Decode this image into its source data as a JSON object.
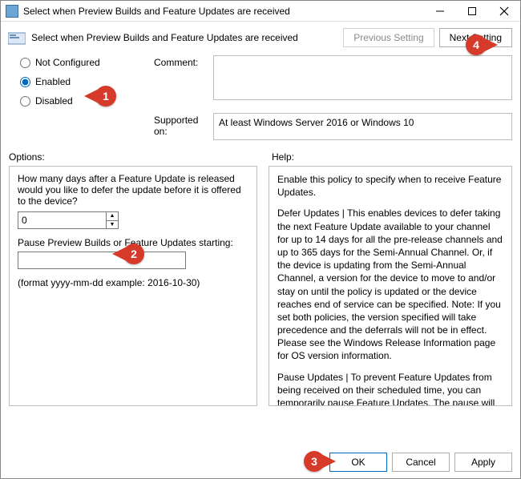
{
  "window": {
    "title": "Select when Preview Builds and Feature Updates are received"
  },
  "header": {
    "subtitle": "Select when Preview Builds and Feature Updates are received",
    "prev_label": "Previous Setting",
    "next_label": "Next Setting"
  },
  "state": {
    "not_configured_label": "Not Configured",
    "enabled_label": "Enabled",
    "disabled_label": "Disabled",
    "selected": "enabled"
  },
  "labels": {
    "comment": "Comment:",
    "supported_on": "Supported on:",
    "options": "Options:",
    "help": "Help:"
  },
  "comment": "",
  "supported_on": "At least Windows Server 2016 or Windows 10",
  "options": {
    "defer_question": "How many days after a Feature Update is released would you like to defer the update before it is offered to the device?",
    "defer_value": "0",
    "pause_label": "Pause Preview Builds or Feature Updates starting:",
    "pause_value": "",
    "format_hint": "(format yyyy-mm-dd example: 2016-10-30)"
  },
  "help": {
    "p1": "Enable this policy to specify when to receive Feature Updates.",
    "p2": "Defer Updates | This enables devices to defer taking the next Feature Update available to your channel for up to 14 days for all the pre-release channels and up to 365 days for the Semi-Annual Channel. Or, if the device is updating from the Semi-Annual Channel, a version for the device to move to and/or stay on until the policy is updated or the device reaches end of service can be specified. Note: If you set both policies, the version specified will take precedence and the deferrals will not be in effect. Please see the Windows Release Information page for OS version information.",
    "p3": "Pause Updates | To prevent Feature Updates from being received on their scheduled time, you can temporarily pause Feature Updates. The pause will remain in effect for 35 days from the specified start date or until the field is cleared (Quality Updates will still be offered)."
  },
  "buttons": {
    "ok": "OK",
    "cancel": "Cancel",
    "apply": "Apply"
  },
  "callouts": {
    "c1": "1",
    "c2": "2",
    "c3": "3",
    "c4": "4"
  }
}
